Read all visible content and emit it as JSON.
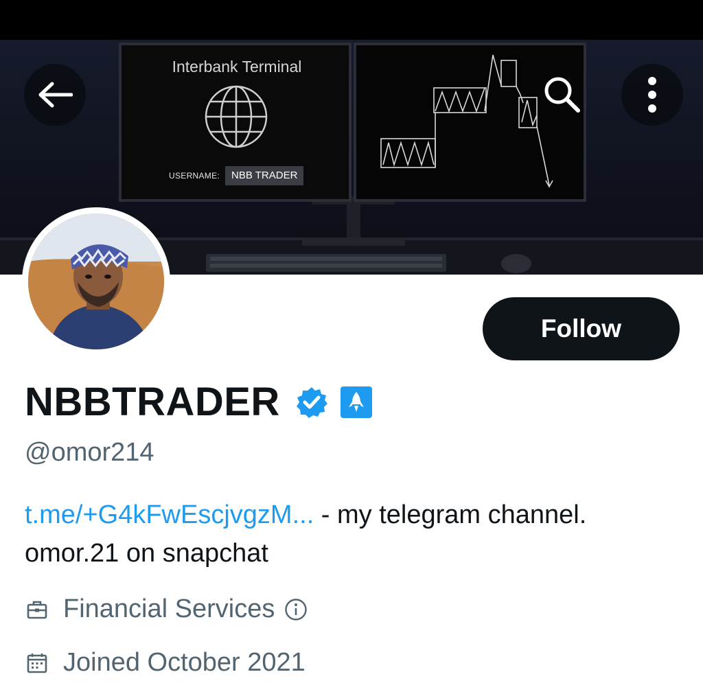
{
  "banner": {
    "title": "Interbank Terminal",
    "username_label": "USERNAME:",
    "username_value": "NBB TRADER"
  },
  "nav": {
    "back_icon": "arrow-left-icon",
    "search_icon": "search-icon",
    "more_icon": "more-vertical-icon"
  },
  "profile": {
    "display_name": "NBBTRADER",
    "handle": "@omor214",
    "follow_label": "Follow",
    "bio_link": "t.me/+G4kFwEscjvgzM...",
    "bio_text_line1": " - my telegram channel.",
    "bio_text_line2": "omor.21 on snapchat",
    "category": "Financial Services",
    "joined": "Joined October 2021"
  },
  "colors": {
    "accent": "#1d9bf0",
    "text_primary": "#0f1419",
    "text_secondary": "#536471"
  }
}
